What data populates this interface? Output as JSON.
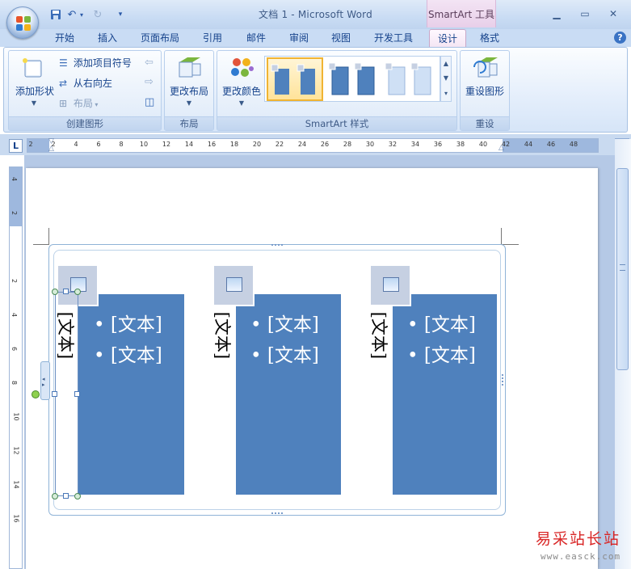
{
  "window": {
    "title": "文档 1 - Microsoft Word",
    "context_tab_title": "SmartArt 工具"
  },
  "tabs": [
    "开始",
    "插入",
    "页面布局",
    "引用",
    "邮件",
    "审阅",
    "视图",
    "开发工具",
    "设计",
    "格式"
  ],
  "ribbon": {
    "create_graphic": {
      "label": "创建图形",
      "add_shape": "添加形状",
      "add_bullet": "添加项目符号",
      "right_to_left": "从右向左",
      "layout": "布局"
    },
    "layouts": {
      "label": "布局",
      "change_layout": "更改布局"
    },
    "styles": {
      "label": "SmartArt 样式",
      "change_colors": "更改颜色"
    },
    "reset": {
      "label": "重设",
      "reset_graphic": "重设图形"
    }
  },
  "ruler": {
    "h_ticks": [
      "2",
      "2",
      "4",
      "6",
      "8",
      "10",
      "12",
      "14",
      "16",
      "18",
      "20",
      "22",
      "24",
      "26",
      "28",
      "30",
      "32",
      "34",
      "36",
      "38",
      "40",
      "42",
      "44",
      "46",
      "48"
    ],
    "v_ticks": [
      "4",
      "2",
      "2",
      "4",
      "6",
      "8",
      "10",
      "12",
      "14",
      "16"
    ]
  },
  "smartart": {
    "placeholder": "[文本]",
    "bullet_item": "• [文本]"
  },
  "watermark": {
    "text": "易采站长站",
    "url": "www.easck.com"
  }
}
